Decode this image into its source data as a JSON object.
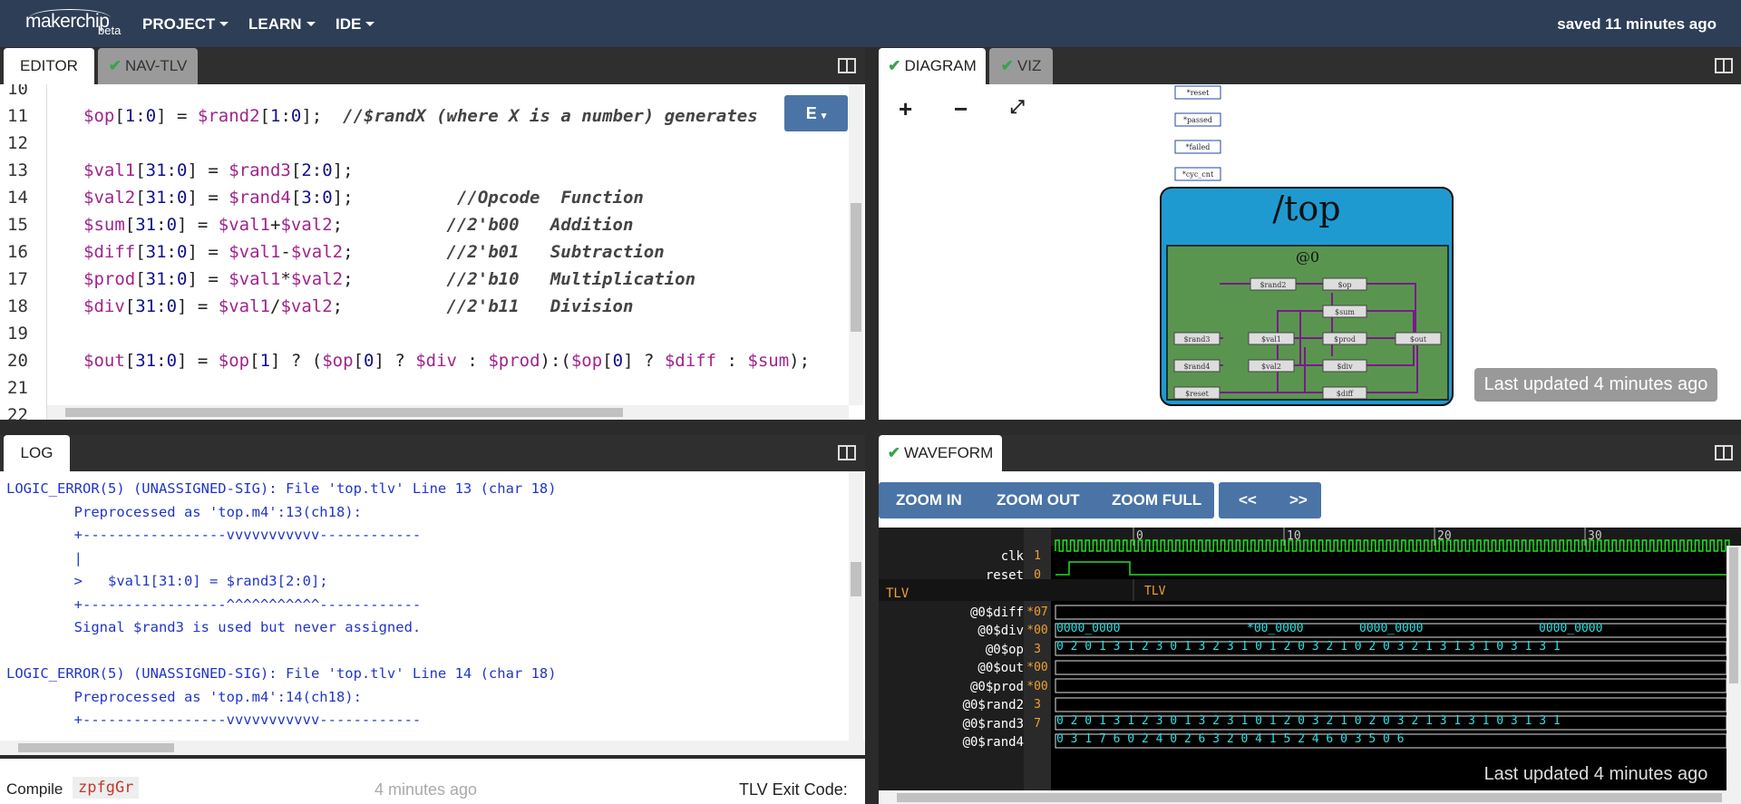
{
  "header": {
    "logo": "makerchip",
    "beta": "beta",
    "menus": [
      "PROJECT",
      "LEARN",
      "IDE"
    ],
    "saved": "saved 11 minutes ago"
  },
  "tabs": {
    "editor": "EDITOR",
    "navtlv": "NAV-TLV",
    "diagram": "DIAGRAM",
    "viz": "VIZ",
    "log": "LOG",
    "waveform": "WAVEFORM"
  },
  "editor": {
    "button": "E",
    "lines": [
      {
        "n": "10",
        "t": ""
      },
      {
        "n": "11",
        "t": "$op[1:0] = $rand2[1:0];  //$randX (where X is a number) generates"
      },
      {
        "n": "12",
        "t": ""
      },
      {
        "n": "13",
        "t": "$val1[31:0] = $rand3[2:0];"
      },
      {
        "n": "14",
        "t": "$val2[31:0] = $rand4[3:0];          //Opcode  Function"
      },
      {
        "n": "15",
        "t": "$sum[31:0] = $val1+$val2;          //2'b00   Addition"
      },
      {
        "n": "16",
        "t": "$diff[31:0] = $val1-$val2;         //2'b01   Subtraction"
      },
      {
        "n": "17",
        "t": "$prod[31:0] = $val1*$val2;         //2'b10   Multiplication"
      },
      {
        "n": "18",
        "t": "$div[31:0] = $val1/$val2;          //2'b11   Division"
      },
      {
        "n": "19",
        "t": ""
      },
      {
        "n": "20",
        "t": "$out[31:0] = $op[1] ? ($op[0] ? $div : $prod):($op[0] ? $diff : $sum);"
      },
      {
        "n": "21",
        "t": ""
      },
      {
        "n": "22",
        "t": ""
      }
    ]
  },
  "diagram": {
    "top_label": "/top",
    "stage": "@0",
    "top_signals": [
      "*reset",
      "*passed",
      "*failed",
      "*cyc_cnt"
    ],
    "nodes": [
      "$rand2",
      "$op",
      "$sum",
      "$rand3",
      "$val1",
      "$prod",
      "$out",
      "$rand4",
      "$val2",
      "$div",
      "$reset",
      "$diff"
    ],
    "last_updated": "Last updated 4 minutes ago"
  },
  "log": {
    "lines": [
      "LOGIC_ERROR(5) (UNASSIGNED-SIG): File 'top.tlv' Line 13 (char 18)",
      "        Preprocessed as 'top.m4':13(ch18):",
      "        +-----------------vvvvvvvvvvv------------",
      "        |",
      "        >   $val1[31:0] = $rand3[2:0];",
      "        +-----------------^^^^^^^^^^^------------",
      "        Signal $rand3 is used but never assigned.",
      "",
      "LOGIC_ERROR(5) (UNASSIGNED-SIG): File 'top.tlv' Line 14 (char 18)",
      "        Preprocessed as 'top.m4':14(ch18):",
      "        +-----------------vvvvvvvvvvv------------"
    ]
  },
  "status": {
    "compile_label": "Compile",
    "compile_id": "zpfgGr",
    "time": "4 minutes ago",
    "exit": "TLV Exit Code:"
  },
  "waveform": {
    "buttons": [
      "ZOOM IN",
      "ZOOM OUT",
      "ZOOM FULL"
    ],
    "nav": [
      "<<",
      ">>"
    ],
    "ticks": [
      "0",
      "10",
      "20",
      "30"
    ],
    "signals": [
      {
        "name": "clk",
        "val": "1"
      },
      {
        "name": "reset",
        "val": "0"
      },
      {
        "name": "TLV",
        "val": ""
      },
      {
        "name": "@0$diff",
        "val": "*07"
      },
      {
        "name": "@0$div",
        "val": "*00"
      },
      {
        "name": "@0$op",
        "val": "3"
      },
      {
        "name": "@0$out",
        "val": "*00"
      },
      {
        "name": "@0$prod",
        "val": "*00"
      },
      {
        "name": "@0$rand2",
        "val": "3"
      },
      {
        "name": "@0$rand3",
        "val": "7"
      },
      {
        "name": "@0$rand4",
        "val": ""
      }
    ],
    "tlv_label": "TLV",
    "div_values": [
      "0000_0000",
      "*00_0000",
      "0000_0000",
      "0000_0000"
    ],
    "op_values": "0 2 0 1 3     1 2   3 0 1 3 2   3 1 0     1 2   0 3 2 1 0 2 0 3 2 1 3 1 3   1 0 3 1 3 1",
    "rand3_values": "0   3   1 7 6   0 2 4 0 2 6   3 2 0 4 1 5 2   4 6 0 3 5 0 6",
    "last_updated": "Last updated 4 minutes ago"
  }
}
